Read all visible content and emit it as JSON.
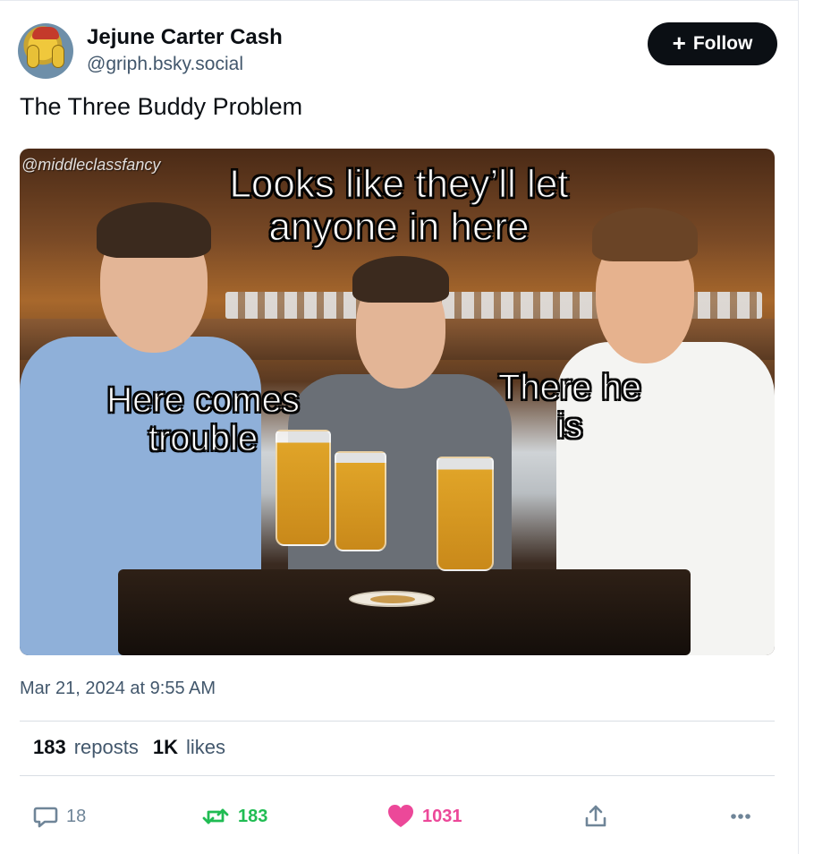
{
  "author": {
    "name": "Jejune Carter Cash",
    "handle": "@griph.bsky.social"
  },
  "follow_button": {
    "label": "Follow"
  },
  "post": {
    "text": "The Three Buddy Problem",
    "image": {
      "watermark": "@middleclassfancy",
      "caption_top": "Looks like they’ll let anyone in here",
      "caption_left": "Here comes trouble",
      "caption_right": "There he is"
    },
    "timestamp": "Mar 21, 2024 at 9:55 AM"
  },
  "stats": {
    "reposts_count": "183",
    "reposts_label": "reposts",
    "likes_count": "1K",
    "likes_label": "likes"
  },
  "actions": {
    "reply_count": "18",
    "repost_count": "183",
    "like_count": "1031"
  },
  "colors": {
    "repost_active": "#20bc53",
    "like_active": "#ec4899",
    "muted": "#6f8598",
    "follow_bg": "#0b0f14"
  },
  "icons": [
    "reply-icon",
    "repost-icon",
    "heart-icon",
    "share-icon",
    "more-icon",
    "plus-icon"
  ]
}
